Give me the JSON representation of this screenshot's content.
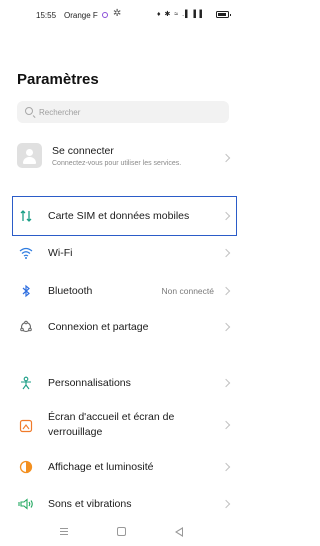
{
  "status_bar": {
    "time": "15:55",
    "carrier": "Orange F",
    "right_icons": "♦ ✱ ≈ .▌▐▐"
  },
  "title": "Paramètres",
  "search": {
    "placeholder": "Rechercher"
  },
  "account": {
    "title": "Se connecter",
    "subtitle": "Connectez-vous pour utiliser les services."
  },
  "rows": [
    {
      "label": "Carte SIM et données mobiles",
      "icon": "sim-data-icon",
      "color": "#1a9e86"
    },
    {
      "label": "Wi-Fi",
      "icon": "wifi-icon",
      "color": "#2f7ce0"
    },
    {
      "label": "Bluetooth",
      "value": "Non connecté",
      "icon": "bluetooth-icon",
      "color": "#2f6fe0"
    },
    {
      "label": "Connexion et partage",
      "icon": "connection-sharing-icon",
      "color": "#666666"
    },
    {
      "label": "Personnalisations",
      "icon": "personalization-icon",
      "color": "#1a9e86"
    },
    {
      "label": "Écran d'accueil et écran de verrouillage",
      "icon": "home-lock-screen-icon",
      "color": "#f07a2a"
    },
    {
      "label": "Affichage et luminosité",
      "icon": "display-brightness-icon",
      "color": "#f39020"
    },
    {
      "label": "Sons et vibrations",
      "icon": "sound-vibration-icon",
      "color": "#22a860"
    }
  ],
  "highlight_color": "#2b5cc8"
}
